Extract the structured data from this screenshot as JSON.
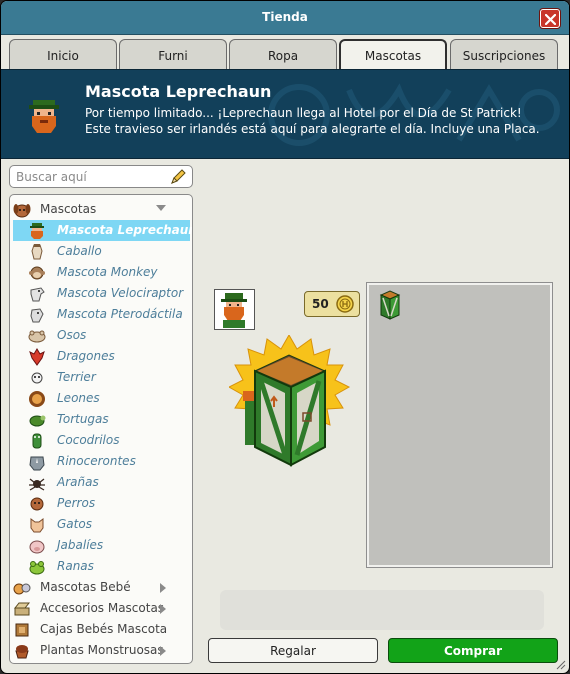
{
  "window": {
    "title": "Tienda"
  },
  "tabs": [
    {
      "label": "Inicio"
    },
    {
      "label": "Furni"
    },
    {
      "label": "Ropa"
    },
    {
      "label": "Mascotas",
      "active": true
    },
    {
      "label": "Suscripciones"
    }
  ],
  "banner": {
    "title": "Mascota Leprechaun",
    "description": "Por tiempo limitado... ¡Leprechaun llega al Hotel por el Día de St Patrick! Este travieso ser irlandés está aquí para alegrarte el día. Incluye una Placa."
  },
  "search": {
    "placeholder": "Buscar aquí",
    "value": ""
  },
  "nav": {
    "categories": [
      {
        "label": "Mascotas",
        "icon": "dog-head-icon",
        "expanded": true
      },
      {
        "label": "Mascotas Bebé",
        "icon": "baby-pets-icon"
      },
      {
        "label": "Accesorios Mascotas",
        "icon": "pet-accessories-icon"
      },
      {
        "label": "Cajas Bebés Mascota",
        "icon": "baby-pet-box-icon"
      },
      {
        "label": "Plantas Monstruosas",
        "icon": "monster-plant-icon"
      }
    ],
    "items": [
      {
        "label": "Mascota Leprechaun",
        "icon": "leprechaun-icon",
        "selected": true
      },
      {
        "label": "Caballo",
        "icon": "horse-icon"
      },
      {
        "label": "Mascota Monkey",
        "icon": "monkey-icon"
      },
      {
        "label": "Mascota Velociraptor",
        "icon": "velociraptor-icon"
      },
      {
        "label": "Mascota Pterodáctila",
        "icon": "pterodactyl-icon"
      },
      {
        "label": "Osos",
        "icon": "bear-icon"
      },
      {
        "label": "Dragones",
        "icon": "dragon-icon"
      },
      {
        "label": "Terrier",
        "icon": "terrier-icon"
      },
      {
        "label": "Leones",
        "icon": "lion-icon"
      },
      {
        "label": "Tortugas",
        "icon": "turtle-icon"
      },
      {
        "label": "Cocodrilos",
        "icon": "crocodile-icon"
      },
      {
        "label": "Rinocerontes",
        "icon": "rhino-icon"
      },
      {
        "label": "Arañas",
        "icon": "spider-icon"
      },
      {
        "label": "Perros",
        "icon": "dog-icon"
      },
      {
        "label": "Gatos",
        "icon": "cat-icon"
      },
      {
        "label": "Jabalíes",
        "icon": "boar-icon"
      },
      {
        "label": "Ranas",
        "icon": "frog-icon"
      }
    ]
  },
  "product": {
    "price": "50",
    "currency_icon": "credit-coin-icon"
  },
  "buttons": {
    "gift": "Regalar",
    "buy": "Comprar"
  },
  "colors": {
    "titlebar": "#3a7a93",
    "banner": "#12405a",
    "selected": "#7ed7f4",
    "buy": "#12a318",
    "link": "#4d7e9a"
  }
}
